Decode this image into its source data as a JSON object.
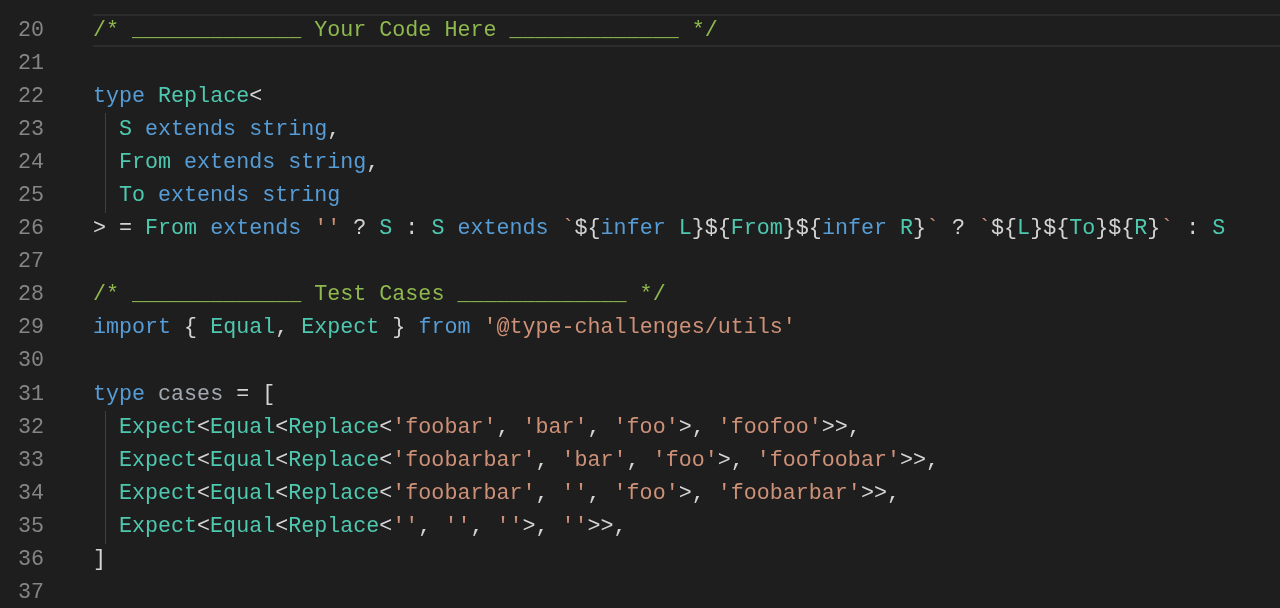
{
  "editor": {
    "lines": [
      {
        "number": "20",
        "current": true,
        "indent_guide": false,
        "tokens": [
          {
            "kind": "comment",
            "text": "/* _____________ Your Code Here _____________ */"
          }
        ]
      },
      {
        "number": "21",
        "current": false,
        "indent_guide": false
      },
      {
        "number": "22",
        "current": false,
        "indent_guide": false,
        "tokens": [
          {
            "kind": "keyword",
            "text": "type"
          },
          {
            "kind": "type",
            "text": " Replace"
          },
          {
            "kind": "plain",
            "text": "<"
          }
        ]
      },
      {
        "number": "23",
        "current": false,
        "indent_guide": true,
        "tokens": [
          {
            "kind": "type",
            "text": "S"
          },
          {
            "kind": "keyword",
            "text": " extends"
          },
          {
            "kind": "keyword",
            "text": " string"
          },
          {
            "kind": "plain",
            "text": ","
          }
        ]
      },
      {
        "number": "24",
        "current": false,
        "indent_guide": true,
        "tokens": [
          {
            "kind": "type",
            "text": "From"
          },
          {
            "kind": "keyword",
            "text": " extends"
          },
          {
            "kind": "keyword",
            "text": " string"
          },
          {
            "kind": "plain",
            "text": ","
          }
        ]
      },
      {
        "number": "25",
        "current": false,
        "indent_guide": true,
        "tokens": [
          {
            "kind": "type",
            "text": "To"
          },
          {
            "kind": "keyword",
            "text": " extends"
          },
          {
            "kind": "keyword",
            "text": " string"
          }
        ]
      },
      {
        "number": "26",
        "current": false,
        "indent_guide": false,
        "tokens": [
          {
            "kind": "plain",
            "text": "> ="
          },
          {
            "kind": "type",
            "text": " From"
          },
          {
            "kind": "keyword",
            "text": " extends"
          },
          {
            "kind": "string",
            "text": " ''"
          },
          {
            "kind": "plain",
            "text": " ?"
          },
          {
            "kind": "type",
            "text": " S"
          },
          {
            "kind": "plain",
            "text": " :"
          },
          {
            "kind": "type",
            "text": " S"
          },
          {
            "kind": "keyword",
            "text": " extends"
          },
          {
            "kind": "string",
            "text": " `"
          },
          {
            "kind": "plain",
            "text": "${"
          },
          {
            "kind": "keyword",
            "text": "infer"
          },
          {
            "kind": "type",
            "text": " L"
          },
          {
            "kind": "plain",
            "text": "}${"
          },
          {
            "kind": "type",
            "text": "From"
          },
          {
            "kind": "plain",
            "text": "}${"
          },
          {
            "kind": "keyword",
            "text": "infer"
          },
          {
            "kind": "type",
            "text": " R"
          },
          {
            "kind": "plain",
            "text": "}"
          },
          {
            "kind": "string",
            "text": "`"
          },
          {
            "kind": "plain",
            "text": " ?"
          },
          {
            "kind": "string",
            "text": " `"
          },
          {
            "kind": "plain",
            "text": "${"
          },
          {
            "kind": "type",
            "text": "L"
          },
          {
            "kind": "plain",
            "text": "}${"
          },
          {
            "kind": "type",
            "text": "To"
          },
          {
            "kind": "plain",
            "text": "}${"
          },
          {
            "kind": "type",
            "text": "R"
          },
          {
            "kind": "plain",
            "text": "}"
          },
          {
            "kind": "string",
            "text": "`"
          },
          {
            "kind": "plain",
            "text": " :"
          },
          {
            "kind": "type",
            "text": " S"
          }
        ]
      },
      {
        "number": "27",
        "current": false,
        "indent_guide": false
      },
      {
        "number": "28",
        "current": false,
        "indent_guide": false,
        "tokens": [
          {
            "kind": "comment",
            "text": "/* _____________ Test Cases _____________ */"
          }
        ]
      },
      {
        "number": "29",
        "current": false,
        "indent_guide": false,
        "tokens": [
          {
            "kind": "keyword",
            "text": "import"
          },
          {
            "kind": "plain",
            "text": " {"
          },
          {
            "kind": "type",
            "text": " Equal"
          },
          {
            "kind": "plain",
            "text": ","
          },
          {
            "kind": "type",
            "text": " Expect"
          },
          {
            "kind": "plain",
            "text": " }"
          },
          {
            "kind": "keyword",
            "text": " from"
          },
          {
            "kind": "string",
            "text": " '@type-challenges/utils'"
          }
        ]
      },
      {
        "number": "30",
        "current": false,
        "indent_guide": false
      },
      {
        "number": "31",
        "current": false,
        "indent_guide": false,
        "tokens": [
          {
            "kind": "keyword",
            "text": "type"
          },
          {
            "kind": "variable",
            "text": " cases"
          },
          {
            "kind": "plain",
            "text": " = ["
          }
        ]
      },
      {
        "number": "32",
        "current": false,
        "indent_guide": true,
        "tokens": [
          {
            "kind": "type",
            "text": "Expect"
          },
          {
            "kind": "plain",
            "text": "<"
          },
          {
            "kind": "type",
            "text": "Equal"
          },
          {
            "kind": "plain",
            "text": "<"
          },
          {
            "kind": "type",
            "text": "Replace"
          },
          {
            "kind": "plain",
            "text": "<"
          },
          {
            "kind": "string",
            "text": "'foobar'"
          },
          {
            "kind": "plain",
            "text": ","
          },
          {
            "kind": "string",
            "text": " 'bar'"
          },
          {
            "kind": "plain",
            "text": ","
          },
          {
            "kind": "string",
            "text": " 'foo'"
          },
          {
            "kind": "plain",
            "text": ">,"
          },
          {
            "kind": "string",
            "text": " 'foofoo'"
          },
          {
            "kind": "plain",
            "text": ">>,"
          }
        ]
      },
      {
        "number": "33",
        "current": false,
        "indent_guide": true,
        "tokens": [
          {
            "kind": "type",
            "text": "Expect"
          },
          {
            "kind": "plain",
            "text": "<"
          },
          {
            "kind": "type",
            "text": "Equal"
          },
          {
            "kind": "plain",
            "text": "<"
          },
          {
            "kind": "type",
            "text": "Replace"
          },
          {
            "kind": "plain",
            "text": "<"
          },
          {
            "kind": "string",
            "text": "'foobarbar'"
          },
          {
            "kind": "plain",
            "text": ","
          },
          {
            "kind": "string",
            "text": " 'bar'"
          },
          {
            "kind": "plain",
            "text": ","
          },
          {
            "kind": "string",
            "text": " 'foo'"
          },
          {
            "kind": "plain",
            "text": ">,"
          },
          {
            "kind": "string",
            "text": " 'foofoobar'"
          },
          {
            "kind": "plain",
            "text": ">>,"
          }
        ]
      },
      {
        "number": "34",
        "current": false,
        "indent_guide": true,
        "tokens": [
          {
            "kind": "type",
            "text": "Expect"
          },
          {
            "kind": "plain",
            "text": "<"
          },
          {
            "kind": "type",
            "text": "Equal"
          },
          {
            "kind": "plain",
            "text": "<"
          },
          {
            "kind": "type",
            "text": "Replace"
          },
          {
            "kind": "plain",
            "text": "<"
          },
          {
            "kind": "string",
            "text": "'foobarbar'"
          },
          {
            "kind": "plain",
            "text": ","
          },
          {
            "kind": "string",
            "text": " ''"
          },
          {
            "kind": "plain",
            "text": ","
          },
          {
            "kind": "string",
            "text": " 'foo'"
          },
          {
            "kind": "plain",
            "text": ">,"
          },
          {
            "kind": "string",
            "text": " 'foobarbar'"
          },
          {
            "kind": "plain",
            "text": ">>,"
          }
        ]
      },
      {
        "number": "35",
        "current": false,
        "indent_guide": true,
        "tokens": [
          {
            "kind": "type",
            "text": "Expect"
          },
          {
            "kind": "plain",
            "text": "<"
          },
          {
            "kind": "type",
            "text": "Equal"
          },
          {
            "kind": "plain",
            "text": "<"
          },
          {
            "kind": "type",
            "text": "Replace"
          },
          {
            "kind": "plain",
            "text": "<"
          },
          {
            "kind": "string",
            "text": "''"
          },
          {
            "kind": "plain",
            "text": ","
          },
          {
            "kind": "string",
            "text": " ''"
          },
          {
            "kind": "plain",
            "text": ","
          },
          {
            "kind": "string",
            "text": " ''"
          },
          {
            "kind": "plain",
            "text": ">,"
          },
          {
            "kind": "string",
            "text": " ''"
          },
          {
            "kind": "plain",
            "text": ">>,"
          }
        ]
      },
      {
        "number": "36",
        "current": false,
        "indent_guide": false,
        "tokens": [
          {
            "kind": "plain",
            "text": "]"
          }
        ]
      },
      {
        "number": "37",
        "current": false,
        "indent_guide": false
      }
    ]
  }
}
